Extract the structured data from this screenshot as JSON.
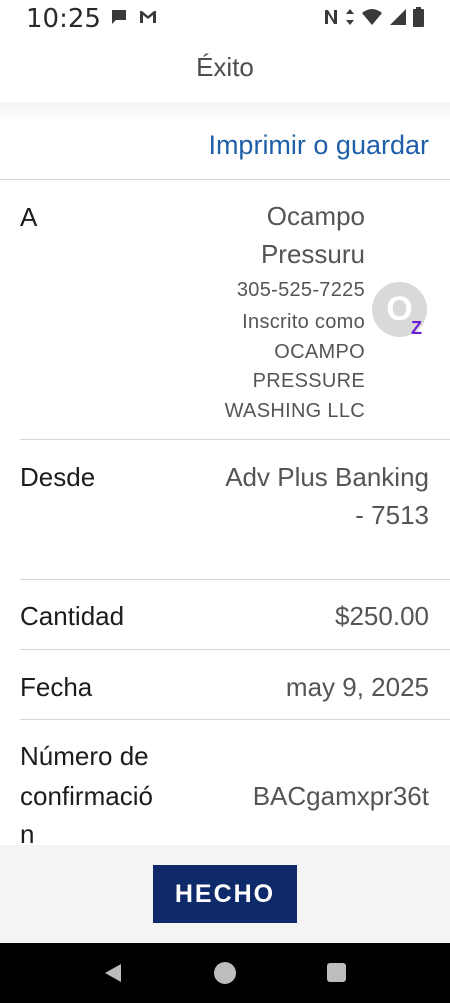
{
  "status_bar": {
    "time": "10:25",
    "left_icons": [
      "chat-bubble-icon",
      "gmail-icon"
    ],
    "right_icons": [
      "nfc-icon",
      "data-arrows-icon",
      "wifi-icon",
      "signal-icon",
      "battery-icon"
    ]
  },
  "header": {
    "title": "Éxito"
  },
  "actions": {
    "print_label": "Imprimir o guardar"
  },
  "details": {
    "to": {
      "label": "A",
      "name_line1": "Ocampo",
      "name_line2": "Pressuru",
      "phone": "305-525-7225",
      "enrolled_line1": "Inscrito como",
      "enrolled_line2": "OCAMPO",
      "enrolled_line3": "PRESSURE",
      "enrolled_line4": "WASHING LLC",
      "avatar_initial": "O",
      "badge": "Z"
    },
    "from": {
      "label": "Desde",
      "value_line1": "Adv Plus Banking",
      "value_line2": "- 7513"
    },
    "amount": {
      "label": "Cantidad",
      "value": "$250.00"
    },
    "date": {
      "label": "Fecha",
      "value": "may 9, 2025"
    },
    "confirmation": {
      "label_line1": "Número de",
      "label_line2": "confirmació",
      "label_line3": "n",
      "value": "BACgamxpr36t"
    }
  },
  "footer": {
    "done_label": "HECHO"
  },
  "colors": {
    "link": "#1f5fa8",
    "button": "#0f2a6b",
    "zelle": "#6d1ed4"
  }
}
